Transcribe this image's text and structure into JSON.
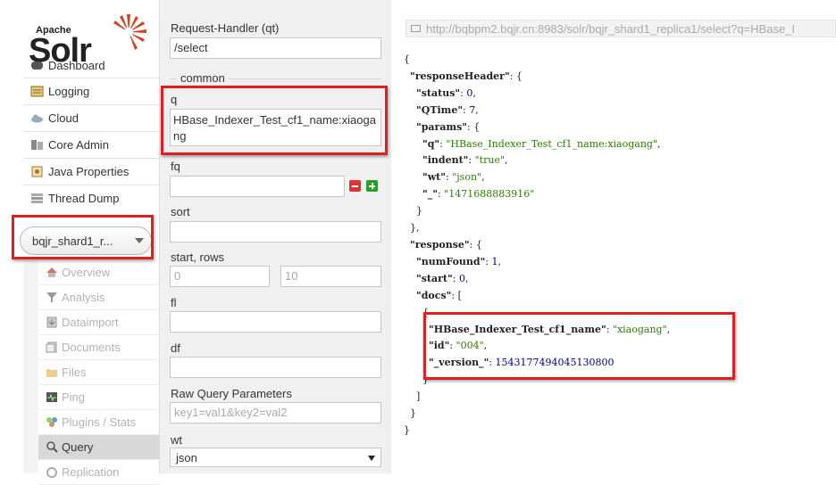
{
  "logo": {
    "top_text": "Apache",
    "main_text": "Solr"
  },
  "nav": [
    {
      "label": "Dashboard",
      "icon": "dashboard-icon"
    },
    {
      "label": "Logging",
      "icon": "logging-icon"
    },
    {
      "label": "Cloud",
      "icon": "cloud-icon"
    },
    {
      "label": "Core Admin",
      "icon": "core-admin-icon"
    },
    {
      "label": "Java Properties",
      "icon": "java-icon"
    },
    {
      "label": "Thread Dump",
      "icon": "thread-dump-icon"
    }
  ],
  "core_selector": {
    "value": "bqjr_shard1_r..."
  },
  "core_menu": [
    {
      "label": "Overview",
      "icon": "home-icon"
    },
    {
      "label": "Analysis",
      "icon": "filter-icon"
    },
    {
      "label": "Dataimport",
      "icon": "dataimport-icon"
    },
    {
      "label": "Documents",
      "icon": "documents-icon"
    },
    {
      "label": "Files",
      "icon": "folder-icon"
    },
    {
      "label": "Ping",
      "icon": "ping-icon"
    },
    {
      "label": "Plugins / Stats",
      "icon": "plugins-icon"
    },
    {
      "label": "Query",
      "icon": "query-icon",
      "active": true
    },
    {
      "label": "Replication",
      "icon": "replication-icon"
    }
  ],
  "form": {
    "qt_label": "Request-Handler (qt)",
    "qt_value": "/select",
    "common_legend": "common",
    "q_label": "q",
    "q_value": "HBase_Indexer_Test_cf1_name:xiaogang",
    "fq_label": "fq",
    "fq_value": "",
    "sort_label": "sort",
    "sort_value": "",
    "start_rows_label": "start, rows",
    "start_placeholder": "0",
    "rows_placeholder": "10",
    "fl_label": "fl",
    "fl_value": "",
    "df_label": "df",
    "df_value": "",
    "raw_label": "Raw Query Parameters",
    "raw_placeholder": "key1=val1&key2=val2",
    "wt_label": "wt",
    "wt_value": "json"
  },
  "result": {
    "url": "http://bqbpm2.bqjr.cn:8983/solr/bqjr_shard1_replica1/select?q=HBase_I",
    "response_header": {
      "status": "0",
      "qtime": "7",
      "params": {
        "q": "\"HBase_Indexer_Test_cf1_name:xiaogang\"",
        "indent": "\"true\"",
        "wt": "\"json\"",
        "underscore": "\"1471688883916\""
      }
    },
    "response": {
      "num_found": "1",
      "start": "0",
      "doc": {
        "name_field": "\"xiaogang\"",
        "id": "\"004\"",
        "version": "1543177494045130800"
      }
    },
    "keys": {
      "responseHeader": "\"responseHeader\"",
      "status": "\"status\"",
      "QTime": "\"QTime\"",
      "params": "\"params\"",
      "q": "\"q\"",
      "indent": "\"indent\"",
      "wt": "\"wt\"",
      "underscore": "\"_\"",
      "response": "\"response\"",
      "numFound": "\"numFound\"",
      "start": "\"start\"",
      "docs": "\"docs\"",
      "name_field": "\"HBase_Indexer_Test_cf1_name\"",
      "id": "\"id\"",
      "version": "\"_version_\""
    }
  },
  "colors": {
    "highlight_box": "#e02020",
    "json_string": "#2a8000",
    "json_number": "#00008b"
  }
}
